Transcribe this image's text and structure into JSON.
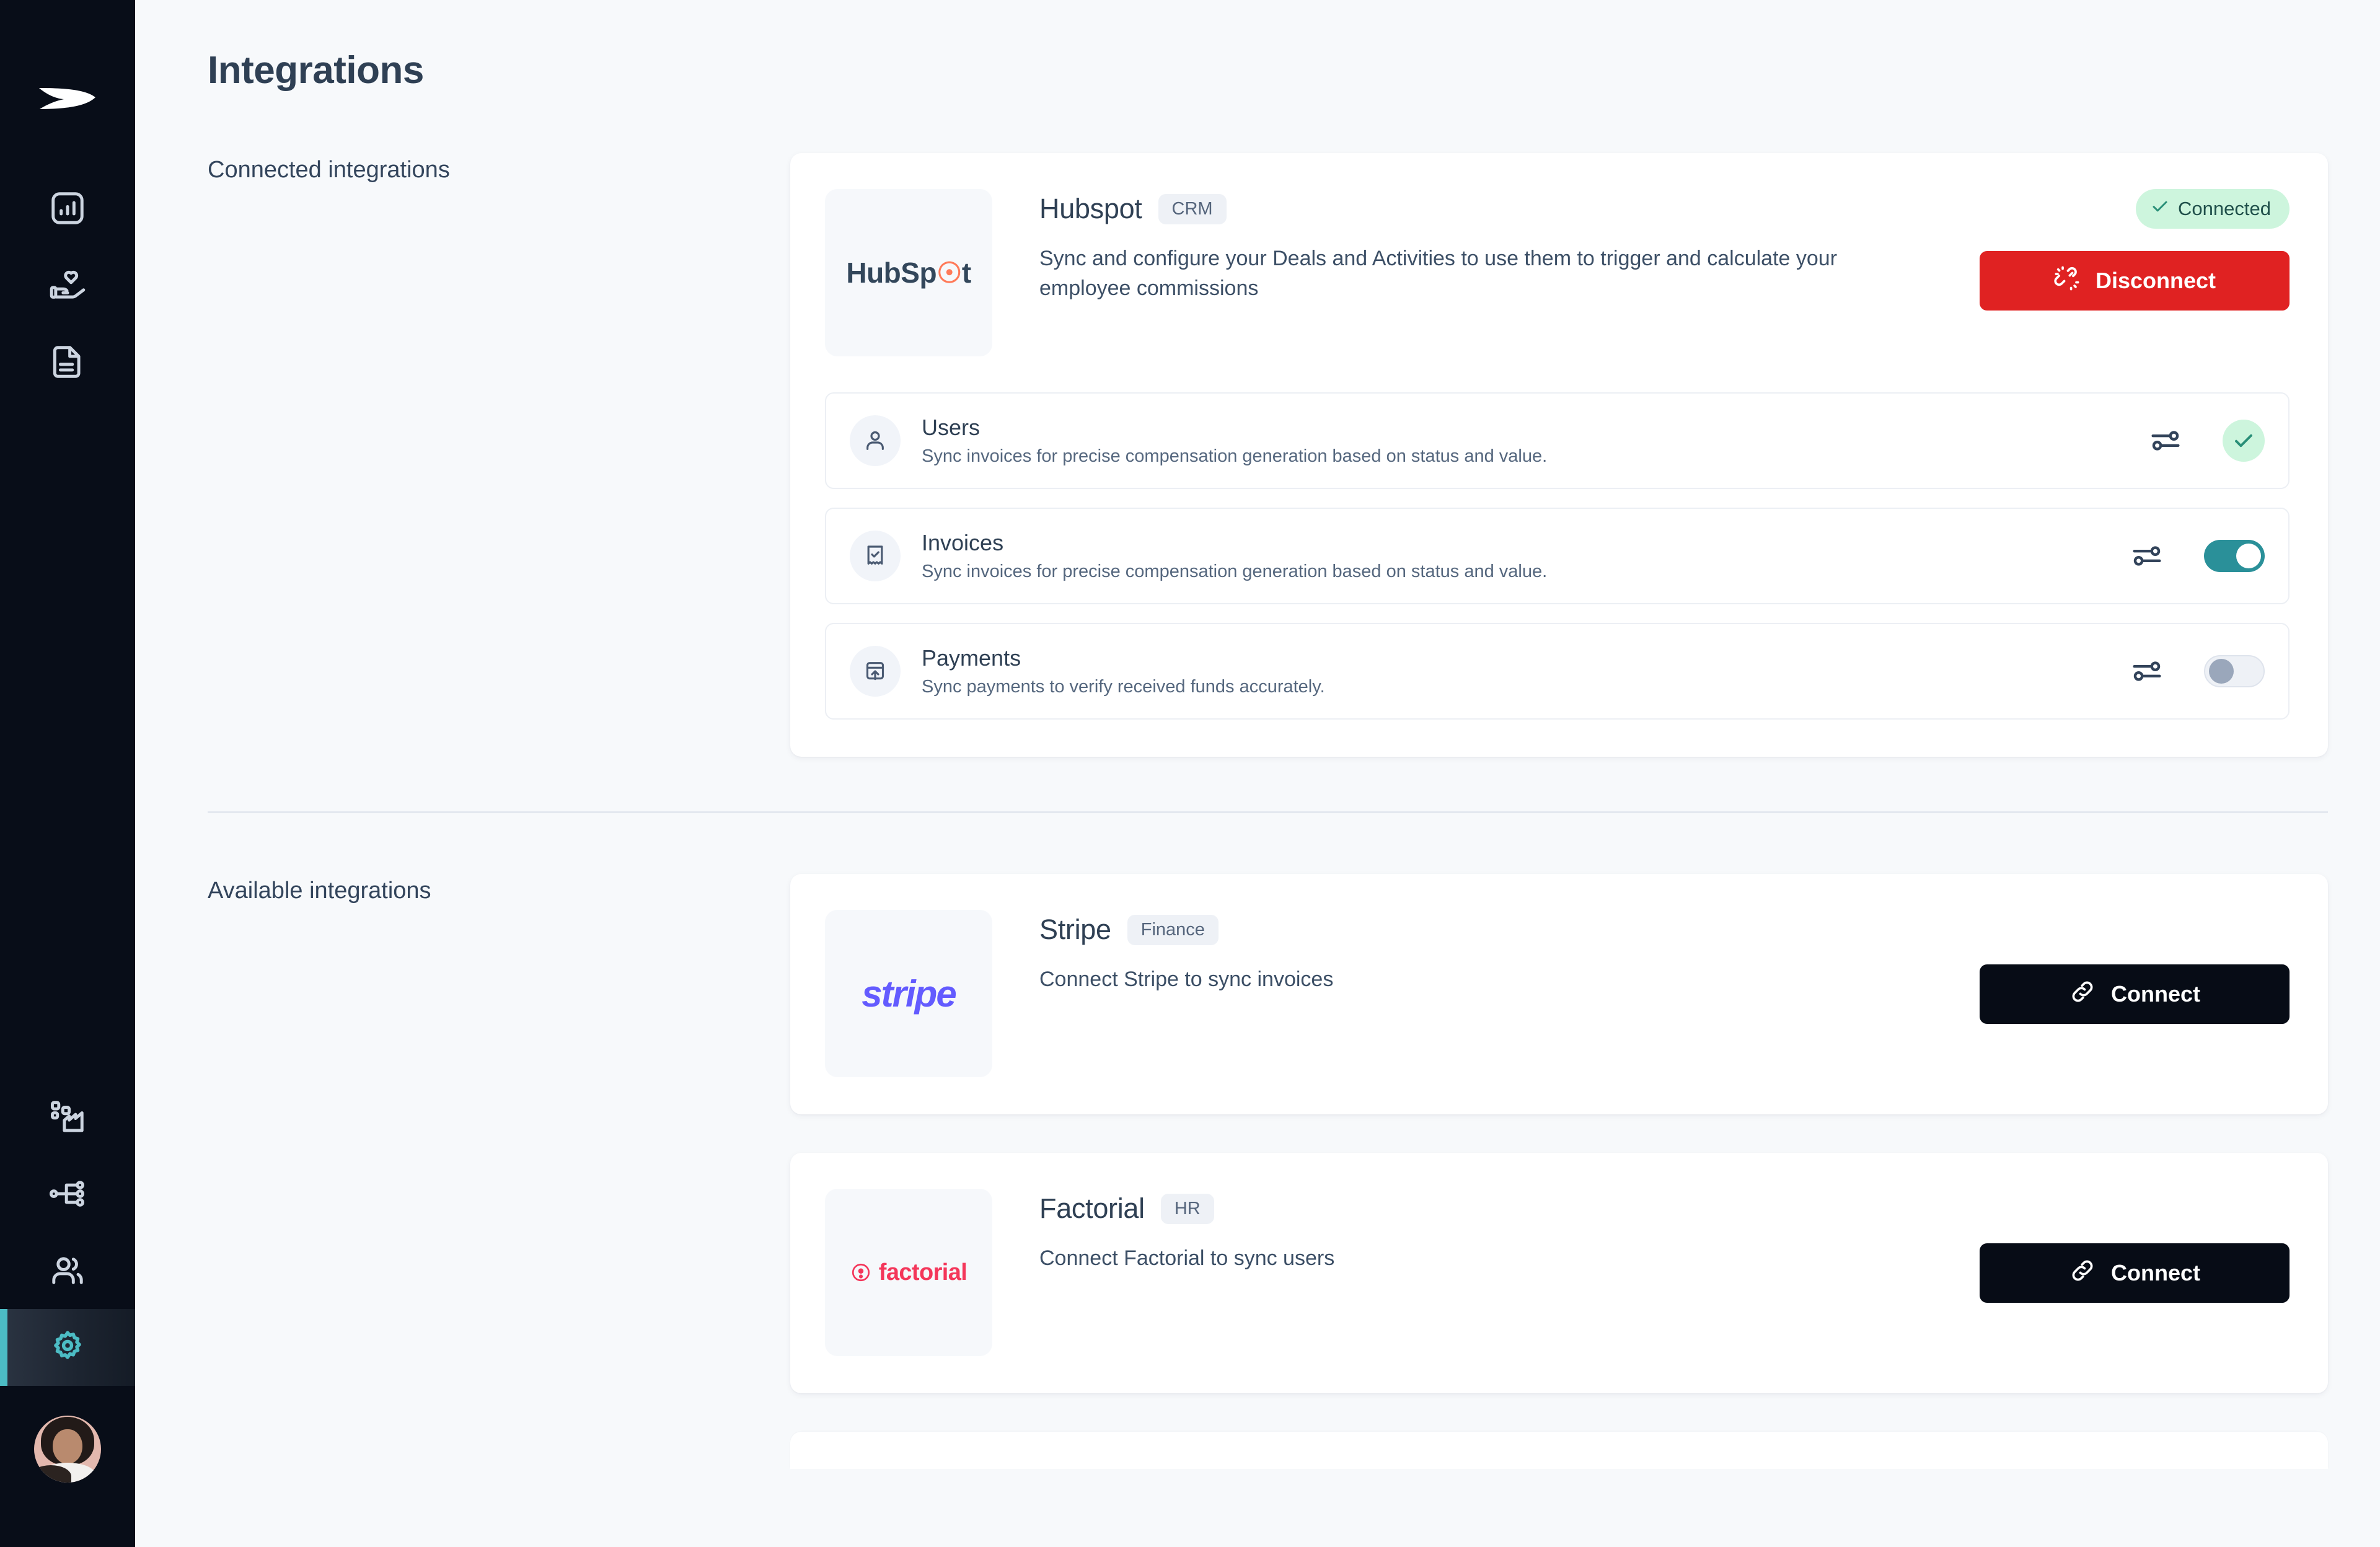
{
  "page": {
    "title": "Integrations"
  },
  "sidebar": {
    "logo_name": "company-logo",
    "top_items": [
      {
        "id": "dashboard",
        "icon": "chart-bar-icon",
        "active": false
      },
      {
        "id": "commissions",
        "icon": "hand-heart-icon",
        "active": false
      },
      {
        "id": "documents",
        "icon": "document-icon",
        "active": false
      }
    ],
    "bottom_items": [
      {
        "id": "plans",
        "icon": "blocks-icon",
        "active": false
      },
      {
        "id": "hierarchy",
        "icon": "sitemap-icon",
        "active": false
      },
      {
        "id": "people",
        "icon": "users-icon",
        "active": false
      },
      {
        "id": "settings",
        "icon": "gear-icon",
        "active": true
      }
    ],
    "avatar_alt": "user-avatar",
    "active_accent": "#4cbcc4"
  },
  "sections": {
    "connected": {
      "label": "Connected integrations",
      "cards": [
        {
          "id": "hubspot",
          "logo": "HubSpot",
          "logo_accent_char": "o",
          "name": "Hubspot",
          "tag": "CRM",
          "description": "Sync and configure your Deals and Activities to use them to trigger and calculate your employee commissions",
          "status": {
            "label": "Connected",
            "icon": "check-icon",
            "bg": "#cdf5dd",
            "fg": "#1f4f4a"
          },
          "action": {
            "label": "Disconnect",
            "icon": "unlink-icon",
            "style": "danger",
            "color": "#e02222"
          },
          "subrows": [
            {
              "id": "users",
              "icon": "user-icon",
              "title": "Users",
              "description": "Sync invoices for precise compensation generation based on status and value.",
              "settings_icon": "sliders-icon",
              "control": "check",
              "checked": true
            },
            {
              "id": "invoices",
              "icon": "invoice-check-icon",
              "title": "Invoices",
              "description": "Sync invoices for precise compensation generation based on status and value.",
              "settings_icon": "sliders-icon",
              "control": "toggle",
              "toggle_on": true
            },
            {
              "id": "payments",
              "icon": "payment-upload-icon",
              "title": "Payments",
              "description": "Sync payments to verify received funds accurately.",
              "settings_icon": "sliders-icon",
              "control": "toggle",
              "toggle_on": false
            }
          ]
        }
      ]
    },
    "available": {
      "label": "Available integrations",
      "cards": [
        {
          "id": "stripe",
          "logo": "stripe",
          "logo_color": "#635bff",
          "name": "Stripe",
          "tag": "Finance",
          "description": "Connect Stripe to sync invoices",
          "action": {
            "label": "Connect",
            "icon": "link-icon",
            "style": "dark",
            "color": "#070c16"
          }
        },
        {
          "id": "factorial",
          "logo": "factorial",
          "logo_color": "#f4365a",
          "name": "Factorial",
          "tag": "HR",
          "description": "Connect Factorial to sync users",
          "action": {
            "label": "Connect",
            "icon": "link-icon",
            "style": "dark",
            "color": "#070c16"
          }
        }
      ]
    }
  }
}
